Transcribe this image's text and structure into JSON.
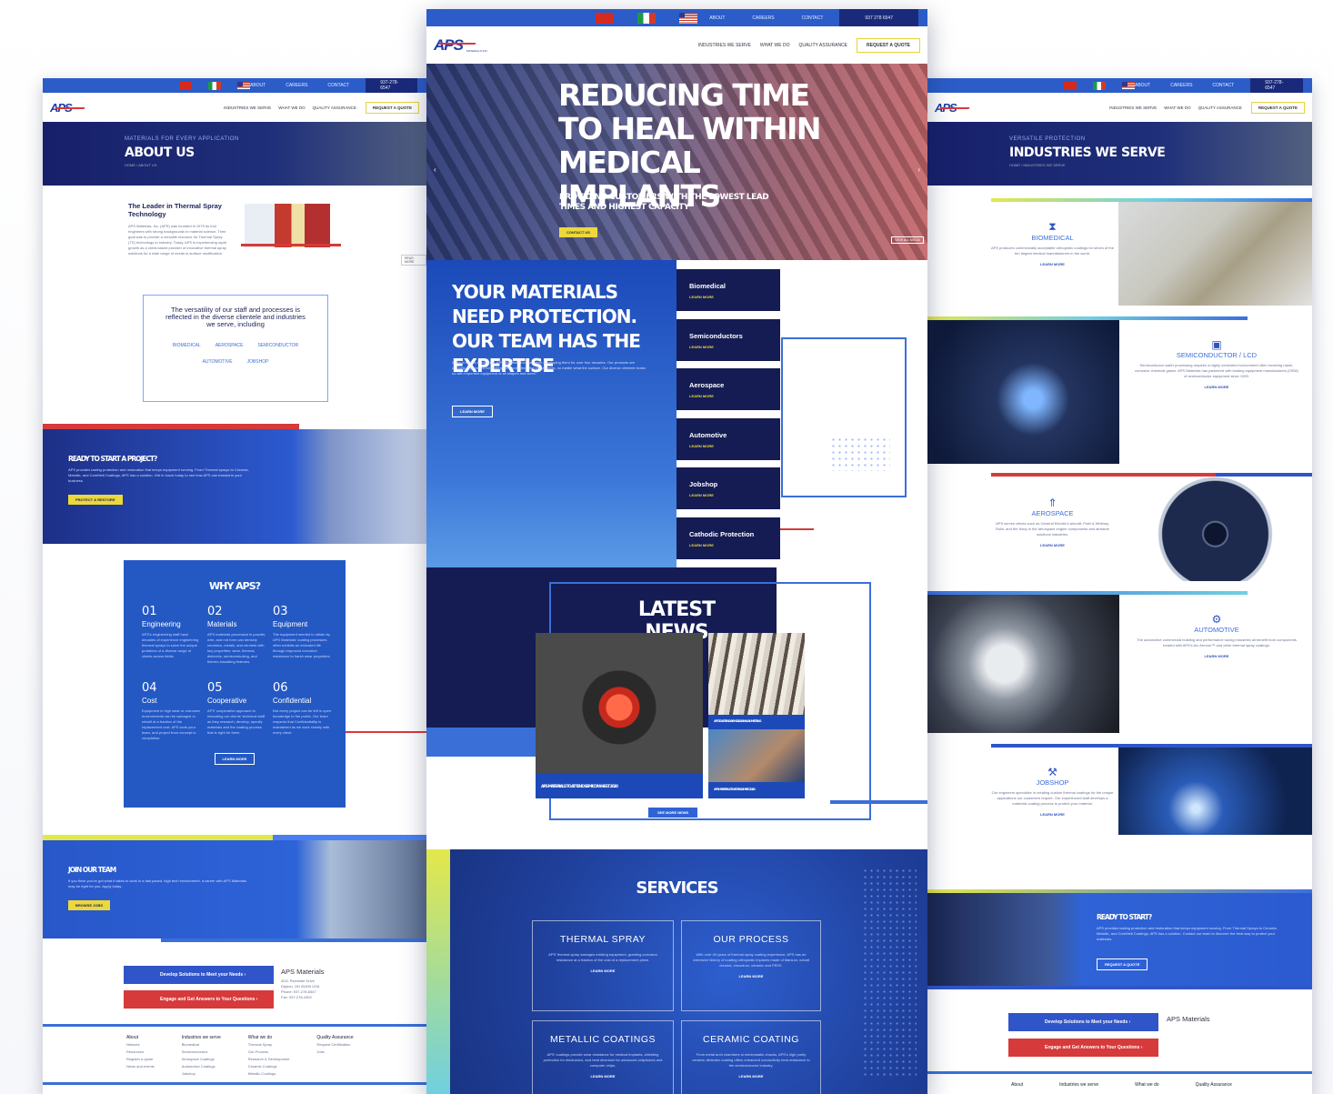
{
  "topbar": {
    "links": [
      "ABOUT",
      "CAREERS",
      "CONTACT"
    ],
    "phone": "937 278 6547",
    "phone_small": "937-278-6547"
  },
  "nav": {
    "logo": "APS",
    "logo_sub": "MATERIALS INC.",
    "links": [
      "INDUSTRIES WE SERVE",
      "WHAT WE DO",
      "QUALITY ASSURANCE"
    ],
    "quote": "REQUEST A QUOTE"
  },
  "about_page": {
    "kicker": "MATERIALS FOR EVERY APPLICATION",
    "title": "ABOUT US",
    "breadcrumb": "HOME  /  ABOUT US",
    "leader_title": "The Leader in Thermal Spray Technology",
    "leader_text": "APS Materials, Inc. (APS) was founded in 1979 by four engineers with strong backgrounds in material science. Their goal was to provide a versatile resource for Thermal Spray (TS) technology to industry. Today, APS is experiencing rapid growth as a client-based provider of innovative thermal spray solutions for a wide range of needs in surface modification.",
    "read_more": "READ MORE",
    "versatility_text": "The versatility of our staff and processes is reflected in the diverse clientele and industries we serve, including",
    "versatility_items": [
      "BIOMEDICAL",
      "AEROSPACE",
      "SEMICONDUCTOR",
      "AUTOMOTIVE",
      "JOBSHOP"
    ],
    "ready_title": "READY TO START A PROJECT?",
    "ready_text": "APS provides lasting protection and restoration that keeps equipment running. From Thermal sprays to Ceramic, Metallic, and CoreMelt Coatings, APS has a solution. Get in touch today to see how APS can transform your business.",
    "ready_button": "PROTECT & RESTORE",
    "why_title": "WHY APS?",
    "why_items": [
      {
        "num": "01",
        "label": "Engineering",
        "text": "APS's engineering staff have decades of experience engineering thermal sprays to solve the unique problems of a diverse range of clients across fields."
      },
      {
        "num": "02",
        "label": "Materials",
        "text": "APS materials processed in powder, wire, and rod form can densely ceramics, metals, and cermets with key properties: wear, thermal, dielectric, semiconducting, and thermo-insulating features."
      },
      {
        "num": "03",
        "label": "Equipment",
        "text": "The equipment needed to obtain by APS Materials' coating processes often exhibits an extended life through improved corrosion resistance to harsh wear properties."
      },
      {
        "num": "04",
        "label": "Cost",
        "text": "Equipment in high wear or corrosive environments can be salvaged or rebuilt at a fraction of the replacement cost. APS work your team, and project from concept to completion."
      },
      {
        "num": "05",
        "label": "Cooperative",
        "text": "APS' cooperative approach to educating our clients' technical staff as they research, develop, specify materials and the coating process that is right for them."
      },
      {
        "num": "06",
        "label": "Confidential",
        "text": "Not every project can be left in open knowledge to the public. Our team respects that Confidentiality is maintained as we work closely with every client."
      }
    ],
    "why_button": "LEARN MORE",
    "join_title": "JOIN OUR TEAM",
    "join_text": "If you think you've got what it takes to work in a fast paced, high tech environment, a career with APS Materials may be right for you. Apply today.",
    "join_button": "BROWSE JOBS",
    "cta_develop": "Develop Solutions to Meet your Needs ›",
    "cta_engage": "Engage and Get Answers to Your Questions ›",
    "company_name": "APS Materials",
    "company_address": "4011 Riverside Drive\nDayton, OH 45405 USA\nPhone: 937-278-6547\nFax: 937-278-4352",
    "footer_cols": [
      {
        "title": "About",
        "items": [
          "Network",
          "Resources",
          "Register a quote",
          "News and events"
        ]
      },
      {
        "title": "Industries we serve",
        "items": [
          "Biomedical",
          "Semiconductors",
          "Aerospace Coatings",
          "Automotive Coatings",
          "Jobshop"
        ]
      },
      {
        "title": "What we do",
        "items": [
          "Thermal Spray",
          "Our Process",
          "Research & Development",
          "Ceramic Coatings",
          "Metallic Coatings"
        ]
      },
      {
        "title": "Quality Assurance",
        "items": [
          "Request Certification",
          "Jobs"
        ]
      }
    ]
  },
  "home_page": {
    "hero_title": "REDUCING TIME TO HEAL WITHIN MEDICAL IMPLANTS",
    "hero_sub": "PROVIDING CUSTOMERS WITH THE LOWEST LEAD TIMES AND HIGHEST CAPACITY",
    "hero_button": "CONTACT US",
    "hero_corner": "VIEW ALL MEDIA",
    "materials_title": "YOUR MATERIALS NEED PROTECTION. OUR TEAM HAS THE EXPERTISE",
    "materials_text": "When it comes to coatings, APS Materials Inc. has been developing them for over four decades. Our products are uniquely engineered for coating and protecting vital components, no matter what the surface. Our diverse clientele trusts us with important equipment of all shapes and sizes.",
    "materials_button": "LEARN MORE",
    "industries": [
      {
        "name": "Biomedical",
        "link": "LEARN MORE"
      },
      {
        "name": "Semiconductors",
        "link": "LEARN MORE"
      },
      {
        "name": "Aerospace",
        "link": "LEARN MORE"
      },
      {
        "name": "Automotive",
        "link": "LEARN MORE"
      },
      {
        "name": "Jobshop",
        "link": "LEARN MORE"
      },
      {
        "name": "Cathodic Protection",
        "link": "LEARN MORE"
      }
    ],
    "news_title": "LATEST NEWS",
    "news": [
      {
        "title": "APS MATERIALS TO ATTEND SEMICON WEST 2020"
      },
      {
        "title": "APS TO ATTEND ASM 2020 ANNUAL MEETING"
      },
      {
        "title": "APS MATERIALS TO ATTEND IMTEC 2020"
      }
    ],
    "news_button": "SEE MORE NEWS",
    "services_title": "SERVICES",
    "services": [
      {
        "title": "THERMAL SPRAY",
        "text": "APS' thermal spray salvages existing equipment, granting corrosion resistance at a fraction of the cost of a replacement piece.",
        "link": "LEARN MORE"
      },
      {
        "title": "OUR PROCESS",
        "text": "With over 40 years of thermal spray coating experience, APS has an extensive history of coating orthopedic implants made of titanium, cobalt chrome, zirconium, ceramic and PEEK.",
        "link": "LEARN MORE"
      },
      {
        "title": "METALLIC COATINGS",
        "text": "APS' coatings provide wear resistance for medical implants, shielding protection for electronics, and heat diversion for advanced cellphones and computer chips.",
        "link": "LEARN MORE"
      },
      {
        "title": "CERAMIC COATING",
        "text": "From metal arch chambers to electrostatic chucks, APS's high purity ceramic dielectric coating offers enhanced conductivity heat resistance to the semiconductor industry.",
        "link": "LEARN MORE"
      }
    ]
  },
  "industries_page": {
    "kicker": "VERSATILE PROTECTION",
    "title": "INDUSTRIES WE SERVE",
    "breadcrumb": "HOME  /  INDUSTRIES WE SERVE",
    "sections": [
      {
        "name": "BIOMEDICAL",
        "text": "APS produces commercially acceptable orthopedic coatings for seven of the ten largest medical manufacturers in the world.",
        "link": "LEARN MORE"
      },
      {
        "name": "SEMICONDUCTOR / LCD",
        "text": "Semiconductor wafer processing requires a highly controlled environment often involving harsh, corrosive chemical gases. APS Materials has partnered with leading equipment manufacturers (OEM) of semiconductor equipment since 1990.",
        "link": "LEARN MORE"
      },
      {
        "name": "AEROSPACE",
        "text": "APS serves clients such as General Electric's aircraft, Pratt & Whitney, Rolls, and the Navy in the aerospace engine components and airframe solutions industries.",
        "link": "LEARN MORE"
      },
      {
        "name": "AUTOMOTIVE",
        "text": "The automotive commercial building and performance racing industries all benefit from components treated with APS's Arc Armour™ and other thermal spray coatings.",
        "link": "LEARN MORE"
      },
      {
        "name": "JOBSHOP",
        "text": "Our engineers specialize in creating custom thermal coatings for the unique applications our customers require. Our experienced staff develops a materials coating process to protect your material.",
        "link": "LEARN MORE"
      }
    ],
    "ready_title": "READY TO START?",
    "ready_text": "APS provides lasting protection and restoration that keeps equipment moving. From Thermal Sprays to Ceramic, Metallic, and CoreMelt Coatings, APS has a solution. Contact our team to discover the best way to protect your materials.",
    "ready_button": "REQUEST A QUOTE",
    "cta_develop": "Develop Solutions to Meet your Needs ›",
    "cta_engage": "Engage and Get Answers to Your Questions ›",
    "company_name": "APS Materials",
    "footer_cols": [
      "About",
      "Industries we serve",
      "What we do",
      "Quality Assurance"
    ]
  },
  "colors": {
    "navy": "#141c53",
    "blue": "#2f63d6",
    "topbar": "#2b5cc8",
    "yellow": "#ecd83a",
    "red": "#d63a3a"
  }
}
